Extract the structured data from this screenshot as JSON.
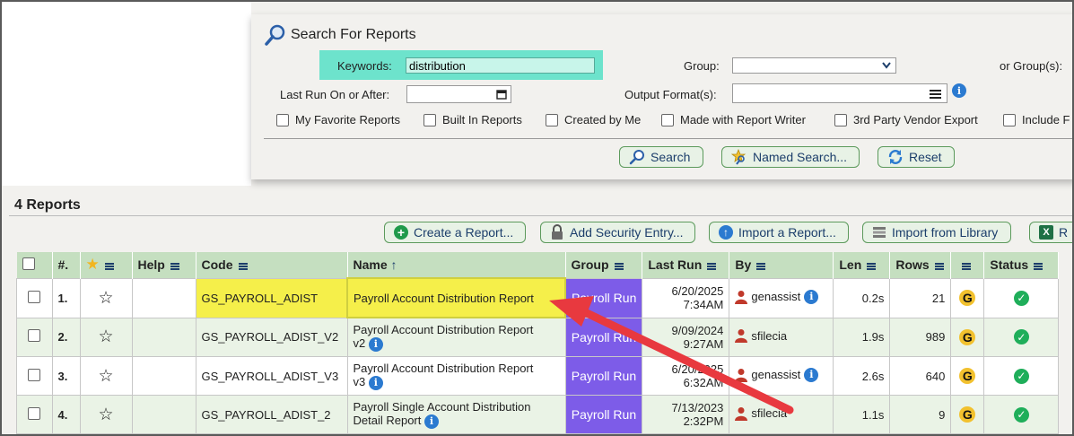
{
  "search": {
    "title": "Search For Reports",
    "keywords_label": "Keywords:",
    "keywords_value": "distribution",
    "group_label": "Group:",
    "or_groups_label": "or Group(s):",
    "last_run_label": "Last Run On or After:",
    "output_format_label": "Output Format(s):",
    "checkboxes": [
      "My Favorite Reports",
      "Built In Reports",
      "Created by Me",
      "Made with Report Writer",
      "3rd Party Vendor Export",
      "Include F"
    ],
    "search_btn": "Search",
    "named_search_btn": "Named Search...",
    "reset_btn": "Reset"
  },
  "reports": {
    "count_label": "4 Reports",
    "toolbar": {
      "create": "Create a Report...",
      "security": "Add Security Entry...",
      "import": "Import a Report...",
      "library": "Import from Library",
      "excel": "R"
    },
    "columns": {
      "num": "#.",
      "help": "Help",
      "code": "Code",
      "name": "Name",
      "name_sort": "↑",
      "group": "Group",
      "last_run": "Last Run",
      "by": "By",
      "len": "Len",
      "rows": "Rows",
      "status": "Status"
    },
    "rows": [
      {
        "num": "1.",
        "code": "GS_PAYROLL_ADIST",
        "name1": "Payroll Account Distribution Report",
        "name2": "",
        "group": "Payroll Run",
        "date": "6/20/2025",
        "time": "7:34AM",
        "by": "genassist",
        "len": "0.2s",
        "rows": "21"
      },
      {
        "num": "2.",
        "code": "GS_PAYROLL_ADIST_V2",
        "name1": "Payroll Account Distribution Report",
        "name2": "v2",
        "group": "Payroll Run",
        "date": "9/09/2024",
        "time": "9:27AM",
        "by": "sfilecia",
        "len": "1.9s",
        "rows": "989"
      },
      {
        "num": "3.",
        "code": "GS_PAYROLL_ADIST_V3",
        "name1": "Payroll Account Distribution Report",
        "name2": "v3",
        "group": "Payroll Run",
        "date": "6/20/2025",
        "time": "6:32AM",
        "by": "genassist",
        "len": "2.6s",
        "rows": "640"
      },
      {
        "num": "4.",
        "code": "GS_PAYROLL_ADIST_2",
        "name1": "Payroll Single Account Distribution",
        "name2": "Detail Report",
        "group": "Payroll Run",
        "date": "7/13/2023",
        "time": "2:32PM",
        "by": "sfilecia",
        "len": "1.1s",
        "rows": "9"
      }
    ]
  },
  "colors": {
    "group_bg": "#7d5ce8",
    "highlight": "#f5ef4a",
    "header_bg": "#c5dfc0",
    "arrow": "#e8393f",
    "keyword_band": "#6de3cc"
  }
}
